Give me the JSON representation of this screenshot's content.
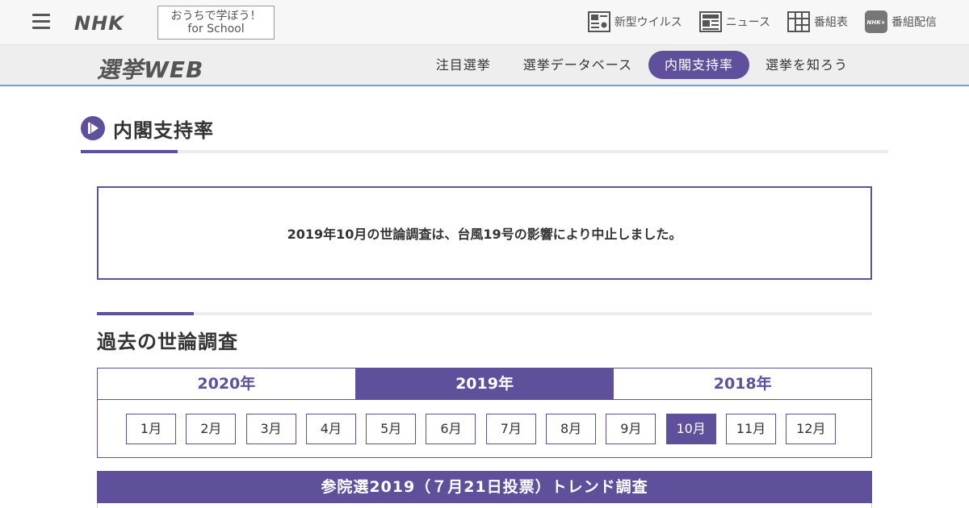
{
  "header": {
    "brand": "NHK",
    "school_line1": "おうちで学ぼう！",
    "school_line2": "for School",
    "nav": [
      {
        "label": "新型ウイルス",
        "icon": "virus-news-icon"
      },
      {
        "label": "ニュース",
        "icon": "news-icon"
      },
      {
        "label": "番組表",
        "icon": "program-grid-icon"
      },
      {
        "label": "番組配信",
        "icon": "nhk-plus-icon"
      }
    ]
  },
  "election_nav": {
    "logo": "選挙WEB",
    "links": [
      "注目選挙",
      "選挙データベース",
      "内閣支持率",
      "選挙を知ろう"
    ],
    "active": "内閣支持率"
  },
  "page": {
    "title": "内閣支持率",
    "notice": "2019年10月の世論調査は、台風19号の影響により中止しました。"
  },
  "past_surveys": {
    "title": "過去の世論調査",
    "years": [
      "2020年",
      "2019年",
      "2018年"
    ],
    "active_year": "2019年",
    "months": [
      "1月",
      "2月",
      "3月",
      "4月",
      "5月",
      "6月",
      "7月",
      "8月",
      "9月",
      "10月",
      "11月",
      "12月"
    ],
    "active_month": "10月",
    "trend_title": "参院選2019（７月21日投票）トレンド調査"
  },
  "colors": {
    "accent": "#60509c",
    "subnav_border": "#5fa9d6"
  }
}
